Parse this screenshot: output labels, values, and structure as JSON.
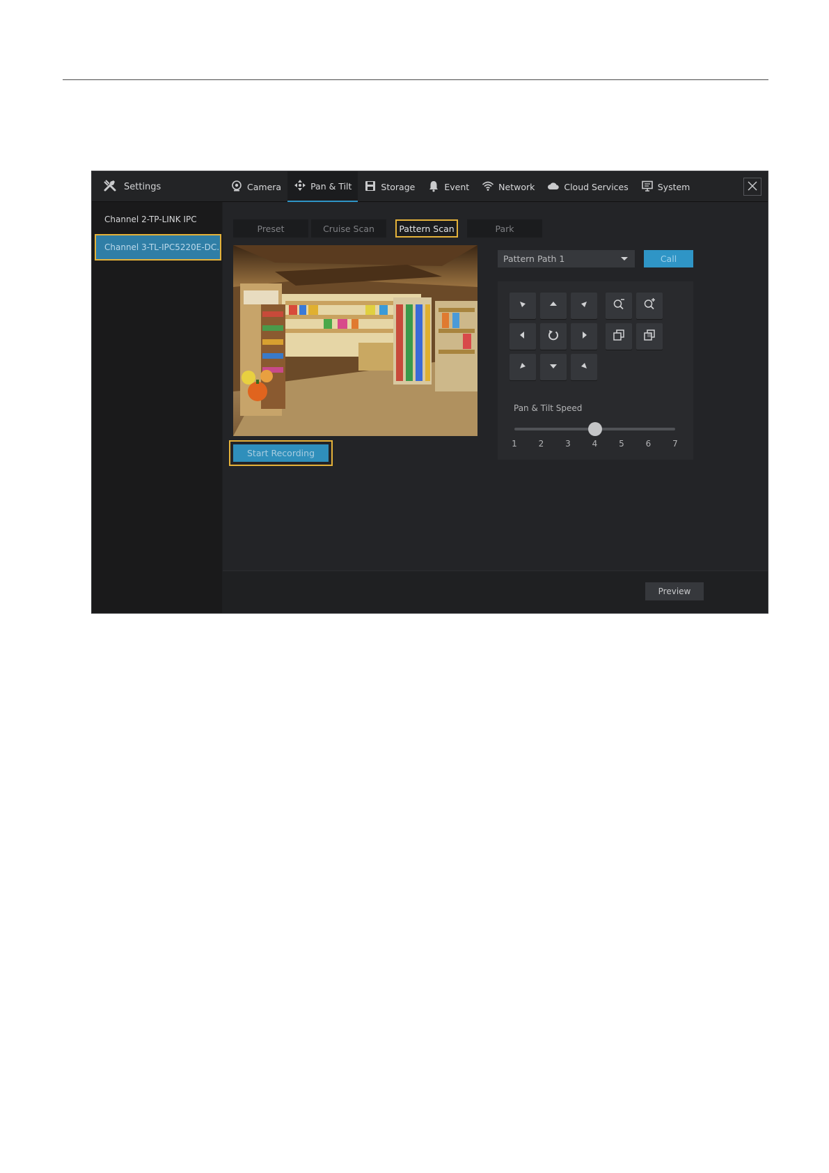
{
  "header": {
    "title": "Settings",
    "nav": [
      {
        "label": "Camera",
        "icon": "camera-icon"
      },
      {
        "label": "Pan & Tilt",
        "icon": "pan-tilt-icon",
        "active": true
      },
      {
        "label": "Storage",
        "icon": "storage-icon"
      },
      {
        "label": "Event",
        "icon": "bell-icon"
      },
      {
        "label": "Network",
        "icon": "wifi-icon"
      },
      {
        "label": "Cloud Services",
        "icon": "cloud-icon"
      },
      {
        "label": "System",
        "icon": "monitor-icon"
      }
    ]
  },
  "sidebar": {
    "channels": [
      {
        "label": "Channel 2-TP-LINK IPC"
      },
      {
        "label": "Channel 3-TL-IPC5220E-DC...",
        "selected": true
      }
    ]
  },
  "tabs": [
    {
      "label": "Preset"
    },
    {
      "label": "Cruise Scan"
    },
    {
      "label": "Pattern Scan",
      "active": true
    },
    {
      "label": "Park"
    }
  ],
  "video": {
    "icon": "camera-feed-store"
  },
  "recording": {
    "label": "Start Recording"
  },
  "pattern": {
    "selected": "Pattern Path 1",
    "call_label": "Call"
  },
  "ptz": {
    "speed_label": "Pan & Tilt Speed",
    "speed_ticks": [
      "1",
      "2",
      "3",
      "4",
      "5",
      "6",
      "7"
    ],
    "speed_value": 4
  },
  "footer": {
    "preview_label": "Preview"
  },
  "colors": {
    "accent": "#2f95c6",
    "highlight": "#e5b23a",
    "background": "#1e1f21"
  }
}
